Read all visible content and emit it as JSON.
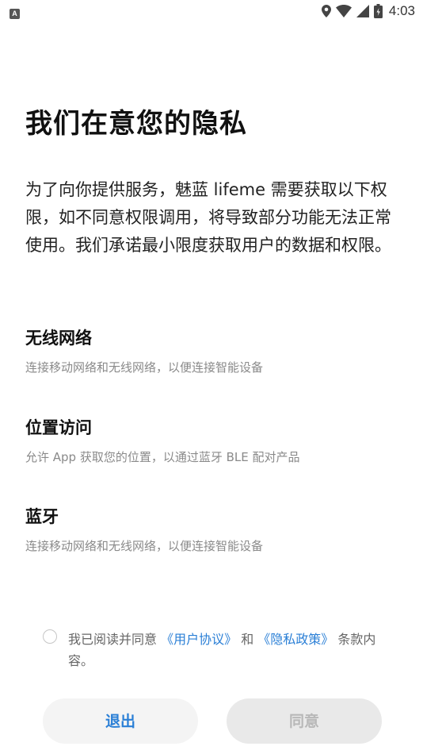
{
  "status_bar": {
    "notification_icon": "A",
    "time": "4:03"
  },
  "title": "我们在意您的隐私",
  "intro": "为了向你提供服务，魅蓝 lifeme 需要获取以下权限，如不同意权限调用，将导致部分功能无法正常使用。我们承诺最小限度获取用户的数据和权限。",
  "permissions": [
    {
      "title": "无线网络",
      "desc": "连接移动网络和无线网络，以便连接智能设备"
    },
    {
      "title": "位置访问",
      "desc": "允许 App 获取您的位置，以通过蓝牙 BLE 配对产品"
    },
    {
      "title": "蓝牙",
      "desc": "连接移动网络和无线网络，以便连接智能设备"
    }
  ],
  "agreement": {
    "prefix": "我已阅读并同意 ",
    "user_agreement": "《用户协议》",
    "and": " 和 ",
    "privacy_policy": "《隐私政策》",
    "suffix": " 条款内容。",
    "checked": false
  },
  "buttons": {
    "exit": "退出",
    "agree": "同意"
  },
  "colors": {
    "link": "#2a7fd6",
    "disabled_text": "#b8b8b8"
  }
}
